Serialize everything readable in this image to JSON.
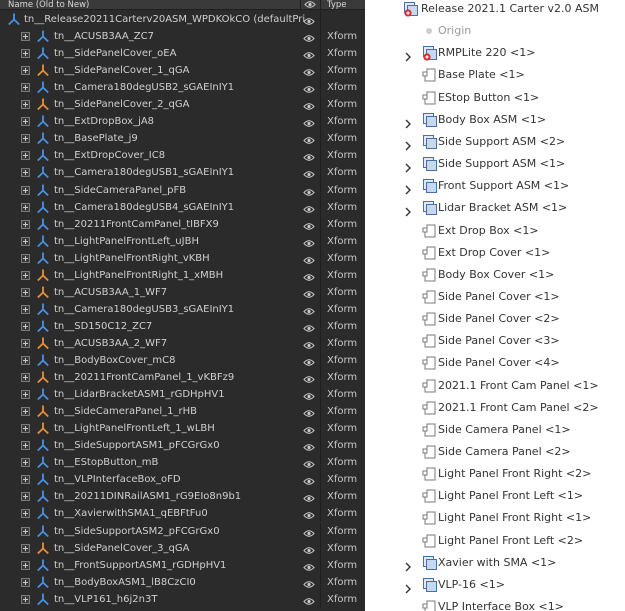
{
  "left_panel": {
    "header": {
      "name_col": "Name (Old to New)",
      "type_col": "Type"
    },
    "root": {
      "label": "tn__Release20211Carterv20ASM_WPDKOkCO (defaultPri"
    },
    "rows": [
      {
        "label": "tn__ACUSB3AA_ZC7",
        "type": "Xform",
        "icon": "xform",
        "accent": false
      },
      {
        "label": "tn__SidePanelCover_oEA",
        "type": "Xform",
        "icon": "xform",
        "accent": false
      },
      {
        "label": "tn__SidePanelCover_1_qGA",
        "type": "Xform",
        "icon": "xform",
        "accent": true
      },
      {
        "label": "tn__Camera180degUSB2_sGAEInIY1",
        "type": "Xform",
        "icon": "xform",
        "accent": false
      },
      {
        "label": "tn__SidePanelCover_2_qGA",
        "type": "Xform",
        "icon": "xform",
        "accent": true
      },
      {
        "label": "tn__ExtDropBox_jA8",
        "type": "Xform",
        "icon": "xform",
        "accent": false
      },
      {
        "label": "tn__BasePlate_j9",
        "type": "Xform",
        "icon": "xform",
        "accent": false
      },
      {
        "label": "tn__ExtDropCover_IC8",
        "type": "Xform",
        "icon": "xform",
        "accent": false
      },
      {
        "label": "tn__Camera180degUSB1_sGAEInIY1",
        "type": "Xform",
        "icon": "xform",
        "accent": false
      },
      {
        "label": "tn__SideCameraPanel_pFB",
        "type": "Xform",
        "icon": "xform",
        "accent": false
      },
      {
        "label": "tn__Camera180degUSB4_sGAEInIY1",
        "type": "Xform",
        "icon": "xform",
        "accent": false
      },
      {
        "label": "tn__20211FrontCamPanel_tIBFX9",
        "type": "Xform",
        "icon": "xform",
        "accent": false
      },
      {
        "label": "tn__LightPanelFrontLeft_uJBH",
        "type": "Xform",
        "icon": "xform",
        "accent": false
      },
      {
        "label": "tn__LightPanelFrontRight_vKBH",
        "type": "Xform",
        "icon": "xform",
        "accent": false
      },
      {
        "label": "tn__LightPanelFrontRight_1_xMBH",
        "type": "Xform",
        "icon": "xform",
        "accent": true
      },
      {
        "label": "tn__ACUSB3AA_1_WF7",
        "type": "Xform",
        "icon": "xform",
        "accent": true
      },
      {
        "label": "tn__Camera180degUSB3_sGAEInIY1",
        "type": "Xform",
        "icon": "xform",
        "accent": false
      },
      {
        "label": "tn__SD150C12_ZC7",
        "type": "Xform",
        "icon": "xform",
        "accent": false
      },
      {
        "label": "tn__ACUSB3AA_2_WF7",
        "type": "Xform",
        "icon": "xform",
        "accent": true
      },
      {
        "label": "tn__BodyBoxCover_mC8",
        "type": "Xform",
        "icon": "xform",
        "accent": false
      },
      {
        "label": "tn__20211FrontCamPanel_1_vKBFz9",
        "type": "Xform",
        "icon": "xform",
        "accent": true
      },
      {
        "label": "tn__LidarBracketASM1_rGDHpHV1",
        "type": "Xform",
        "icon": "xform",
        "accent": false
      },
      {
        "label": "tn__SideCameraPanel_1_rHB",
        "type": "Xform",
        "icon": "xform",
        "accent": true
      },
      {
        "label": "tn__LightPanelFrontLeft_1_wLBH",
        "type": "Xform",
        "icon": "xform",
        "accent": true
      },
      {
        "label": "tn__SideSupportASM1_pFCGrGx0",
        "type": "Xform",
        "icon": "xform",
        "accent": false
      },
      {
        "label": "tn__EStopButton_mB",
        "type": "Xform",
        "icon": "xform",
        "accent": false
      },
      {
        "label": "tn__VLPInterfaceBox_oFD",
        "type": "Xform",
        "icon": "xform",
        "accent": false
      },
      {
        "label": "tn__20211DINRailASM1_rG9EIo8n9b1",
        "type": "Xform",
        "icon": "xform",
        "accent": false
      },
      {
        "label": "tn__XavierwithSMA1_qEBFtFu0",
        "type": "Xform",
        "icon": "xform",
        "accent": false
      },
      {
        "label": "tn__SideSupportASM2_pFCGrGx0",
        "type": "Xform",
        "icon": "xform",
        "accent": false
      },
      {
        "label": "tn__SidePanelCover_3_qGA",
        "type": "Xform",
        "icon": "xform",
        "accent": true
      },
      {
        "label": "tn__FrontSupportASM1_rGDHpHV1",
        "type": "Xform",
        "icon": "xform",
        "accent": false
      },
      {
        "label": "tn__BodyBoxASM1_lB8CzCI0",
        "type": "Xform",
        "icon": "xform",
        "accent": false
      },
      {
        "label": "tn__VLP161_h6j2n3T",
        "type": "Xform",
        "icon": "xform",
        "accent": false
      }
    ]
  },
  "right_panel": {
    "rows": [
      {
        "label": "Release 2021.1 Carter v2.0 ASM",
        "kind": "asm-root",
        "chev": false,
        "indent": 0
      },
      {
        "label": "Origin",
        "kind": "origin",
        "chev": false,
        "indent": 1
      },
      {
        "label": "RMPLite 220 <1>",
        "kind": "asm-red",
        "chev": true,
        "indent": 1
      },
      {
        "label": "Base Plate <1>",
        "kind": "part",
        "chev": false,
        "indent": 1
      },
      {
        "label": "EStop Button <1>",
        "kind": "part",
        "chev": false,
        "indent": 1
      },
      {
        "label": "Body Box ASM <1>",
        "kind": "asm",
        "chev": true,
        "indent": 1
      },
      {
        "label": "Side Support ASM <2>",
        "kind": "asm",
        "chev": true,
        "indent": 1
      },
      {
        "label": "Side Support ASM <1>",
        "kind": "asm",
        "chev": true,
        "indent": 1
      },
      {
        "label": "Front Support ASM <1>",
        "kind": "asm",
        "chev": true,
        "indent": 1
      },
      {
        "label": "Lidar Bracket ASM <1>",
        "kind": "asm",
        "chev": true,
        "indent": 1
      },
      {
        "label": "Ext Drop Box <1>",
        "kind": "part",
        "chev": false,
        "indent": 1
      },
      {
        "label": "Ext Drop Cover <1>",
        "kind": "part",
        "chev": false,
        "indent": 1
      },
      {
        "label": "Body Box Cover <1>",
        "kind": "part",
        "chev": false,
        "indent": 1
      },
      {
        "label": "Side Panel Cover <1>",
        "kind": "part",
        "chev": false,
        "indent": 1
      },
      {
        "label": "Side Panel Cover <2>",
        "kind": "part",
        "chev": false,
        "indent": 1
      },
      {
        "label": "Side Panel Cover <3>",
        "kind": "part",
        "chev": false,
        "indent": 1
      },
      {
        "label": "Side Panel Cover <4>",
        "kind": "part",
        "chev": false,
        "indent": 1
      },
      {
        "label": "2021.1 Front Cam Panel <1>",
        "kind": "part",
        "chev": false,
        "indent": 1
      },
      {
        "label": "2021.1 Front Cam Panel <2>",
        "kind": "part",
        "chev": false,
        "indent": 1
      },
      {
        "label": "Side Camera Panel <1>",
        "kind": "part",
        "chev": false,
        "indent": 1
      },
      {
        "label": "Side Camera Panel <2>",
        "kind": "part",
        "chev": false,
        "indent": 1
      },
      {
        "label": "Light Panel Front Right <2>",
        "kind": "part",
        "chev": false,
        "indent": 1
      },
      {
        "label": "Light Panel Front Left <1>",
        "kind": "part",
        "chev": false,
        "indent": 1
      },
      {
        "label": "Light Panel Front Right <1>",
        "kind": "part",
        "chev": false,
        "indent": 1
      },
      {
        "label": "Light Panel Front Left <2>",
        "kind": "part",
        "chev": false,
        "indent": 1
      },
      {
        "label": "Xavier with SMA <1>",
        "kind": "asm",
        "chev": true,
        "indent": 1
      },
      {
        "label": "VLP-16 <1>",
        "kind": "asm",
        "chev": true,
        "indent": 1
      },
      {
        "label": "VLP Interface Box <1>",
        "kind": "part",
        "chev": false,
        "indent": 1
      }
    ]
  },
  "colors": {
    "dark_bg": "#2b2b2b",
    "xform_blue": "#4a90e2",
    "xform_orange": "#e8903a",
    "eye": "#c8c8c8"
  }
}
